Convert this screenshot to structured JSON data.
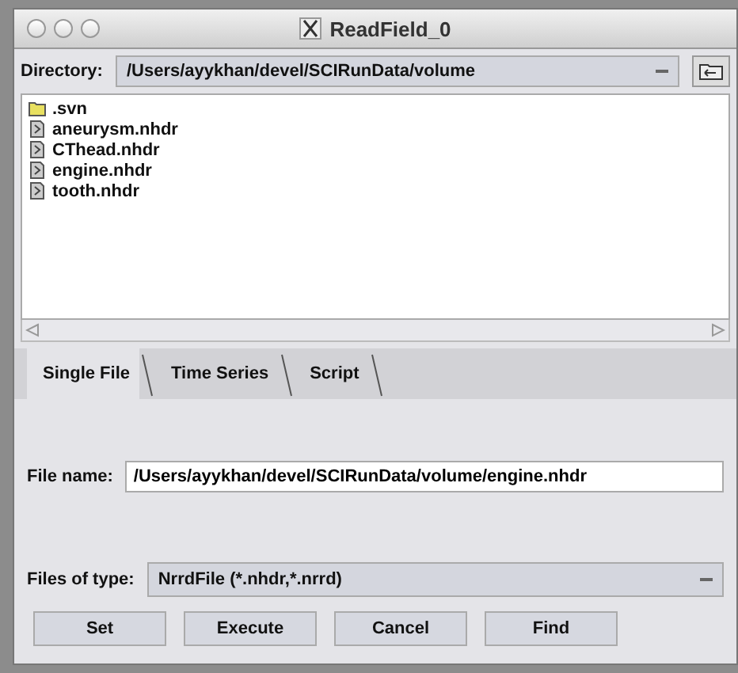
{
  "window": {
    "title": "ReadField_0"
  },
  "directory": {
    "label": "Directory:",
    "value": "/Users/ayykhan/devel/SCIRunData/volume"
  },
  "files": [
    {
      "name": ".svn",
      "kind": "folder"
    },
    {
      "name": "aneurysm.nhdr",
      "kind": "file"
    },
    {
      "name": "CThead.nhdr",
      "kind": "file"
    },
    {
      "name": "engine.nhdr",
      "kind": "file"
    },
    {
      "name": "tooth.nhdr",
      "kind": "file"
    }
  ],
  "tabs": [
    {
      "label": "Single File",
      "selected": true
    },
    {
      "label": "Time Series",
      "selected": false
    },
    {
      "label": "Script",
      "selected": false
    }
  ],
  "file_name": {
    "label": "File name:",
    "value": "/Users/ayykhan/devel/SCIRunData/volume/engine.nhdr"
  },
  "files_of_type": {
    "label": "Files of type:",
    "value": "NrrdFile (*.nhdr,*.nrrd)"
  },
  "buttons": [
    "Set",
    "Execute",
    "Cancel",
    "Find"
  ]
}
